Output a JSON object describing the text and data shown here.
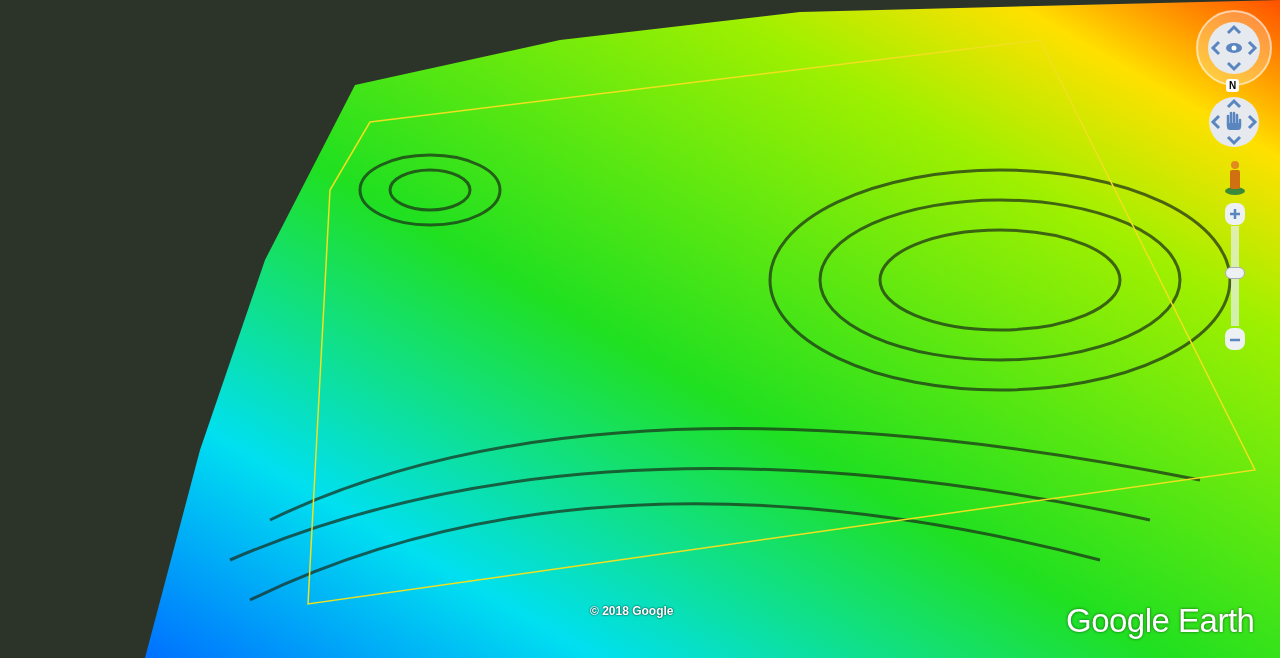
{
  "map": {
    "copyright": "© 2018 Google",
    "logo": "Google Earth"
  },
  "controls": {
    "compass_label": "N",
    "zoom_slider": {
      "level": 0.53
    }
  }
}
